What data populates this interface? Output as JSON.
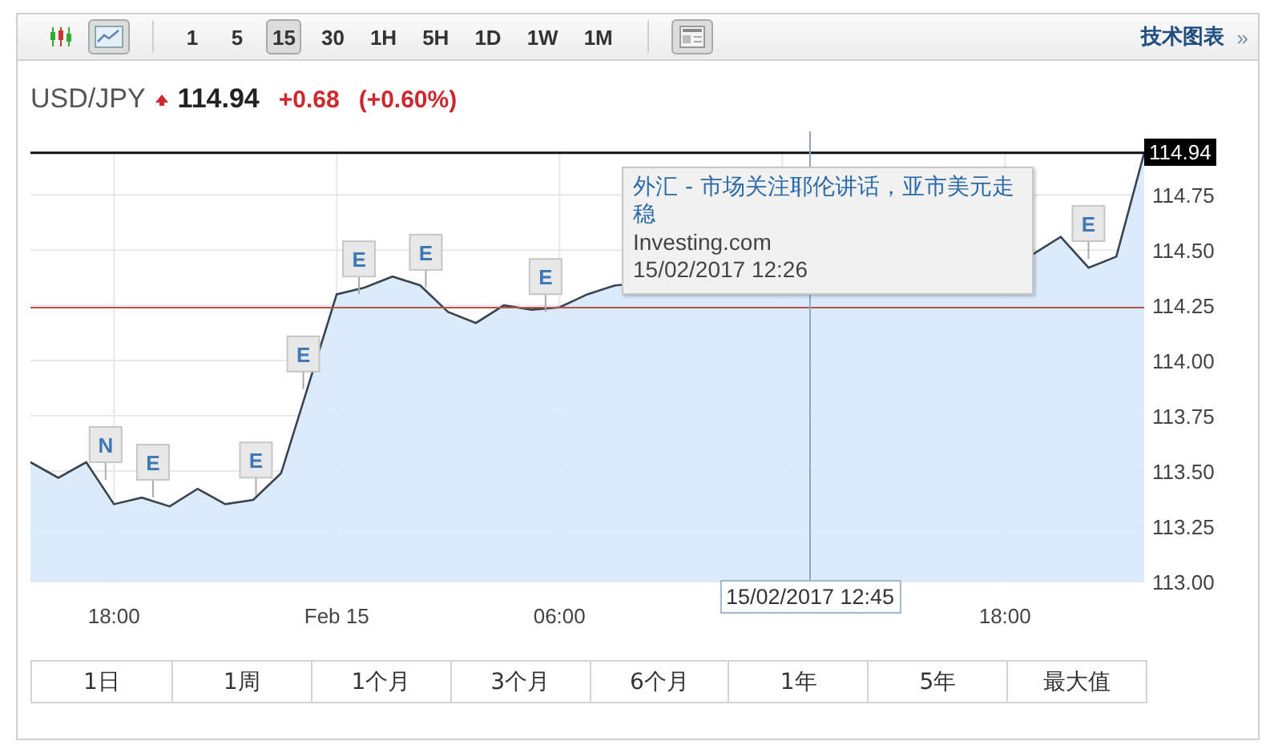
{
  "toolbar": {
    "chart_types": [
      {
        "kind": "candles",
        "selected": false
      },
      {
        "kind": "line",
        "selected": true
      }
    ],
    "intervals": [
      {
        "label": "1",
        "selected": false
      },
      {
        "label": "5",
        "selected": false
      },
      {
        "label": "15",
        "selected": true
      },
      {
        "label": "30",
        "selected": false
      },
      {
        "label": "1H",
        "selected": false
      },
      {
        "label": "5H",
        "selected": false
      },
      {
        "label": "1D",
        "selected": false
      },
      {
        "label": "1W",
        "selected": false
      },
      {
        "label": "1M",
        "selected": false
      }
    ],
    "link": {
      "label": "技术图表",
      "arrow": "»"
    }
  },
  "quote": {
    "symbol": "USD/JPY",
    "rising": true,
    "price": "114.94",
    "change": "+0.68",
    "change_pct": "(+0.60%)"
  },
  "chart": {
    "chart_data": {
      "type": "area",
      "ylim": [
        113,
        114.95
      ],
      "categories": [
        null,
        null,
        null,
        "18:00",
        null,
        null,
        null,
        null,
        null,
        null,
        null,
        "Feb 15",
        null,
        null,
        null,
        null,
        null,
        null,
        null,
        "06:00",
        null,
        null,
        null,
        null,
        null,
        null,
        null,
        null,
        null,
        null,
        null,
        null,
        null,
        null,
        null,
        "18:00",
        null,
        null,
        null,
        null,
        null
      ],
      "values": [
        113.54,
        113.47,
        113.54,
        113.35,
        113.38,
        113.34,
        113.42,
        113.35,
        113.37,
        113.49,
        null,
        114.3,
        114.33,
        114.38,
        114.34,
        114.22,
        114.17,
        114.25,
        114.23,
        114.24,
        114.3,
        114.34,
        null,
        null,
        null,
        null,
        null,
        null,
        null,
        null,
        null,
        null,
        null,
        null,
        null,
        null,
        114.48,
        114.56,
        114.42,
        114.47,
        114.94
      ],
      "grid": true,
      "yticks": [
        {
          "value": 113,
          "label": "113.00"
        },
        {
          "value": 113.25,
          "label": "113.25"
        },
        {
          "value": 113.5,
          "label": "113.50"
        },
        {
          "value": 113.75,
          "label": "113.75"
        },
        {
          "value": 114,
          "label": "114.00"
        },
        {
          "value": 114.25,
          "label": "114.25"
        },
        {
          "value": 114.5,
          "label": "114.50"
        },
        {
          "value": 114.75,
          "label": "114.75"
        }
      ],
      "ref_lines": [
        {
          "axis": "y",
          "value": 114.24
        }
      ]
    },
    "last_price_tag": "114.94",
    "events": [
      {
        "text": "N"
      },
      {
        "text": "E"
      },
      {
        "text": "E"
      },
      {
        "text": "E"
      },
      {
        "text": "E"
      },
      {
        "text": "E"
      },
      {
        "text": "E"
      },
      {
        "text": "E"
      }
    ],
    "crosshair": {
      "label": "15/02/2017 12:45"
    },
    "tooltip": {
      "title": "外汇 - 市场关注耶伦讲话，亚市美元走稳",
      "source": "Investing.com",
      "time": "15/02/2017 12:26"
    }
  },
  "ranges": [
    {
      "label": "1日",
      "selected": false
    },
    {
      "label": "1周",
      "selected": false
    },
    {
      "label": "1个月",
      "selected": false
    },
    {
      "label": "3个月",
      "selected": false
    },
    {
      "label": "6个月",
      "selected": false
    },
    {
      "label": "1年",
      "selected": false
    },
    {
      "label": "5年",
      "selected": false
    },
    {
      "label": "最大值",
      "selected": false
    }
  ]
}
